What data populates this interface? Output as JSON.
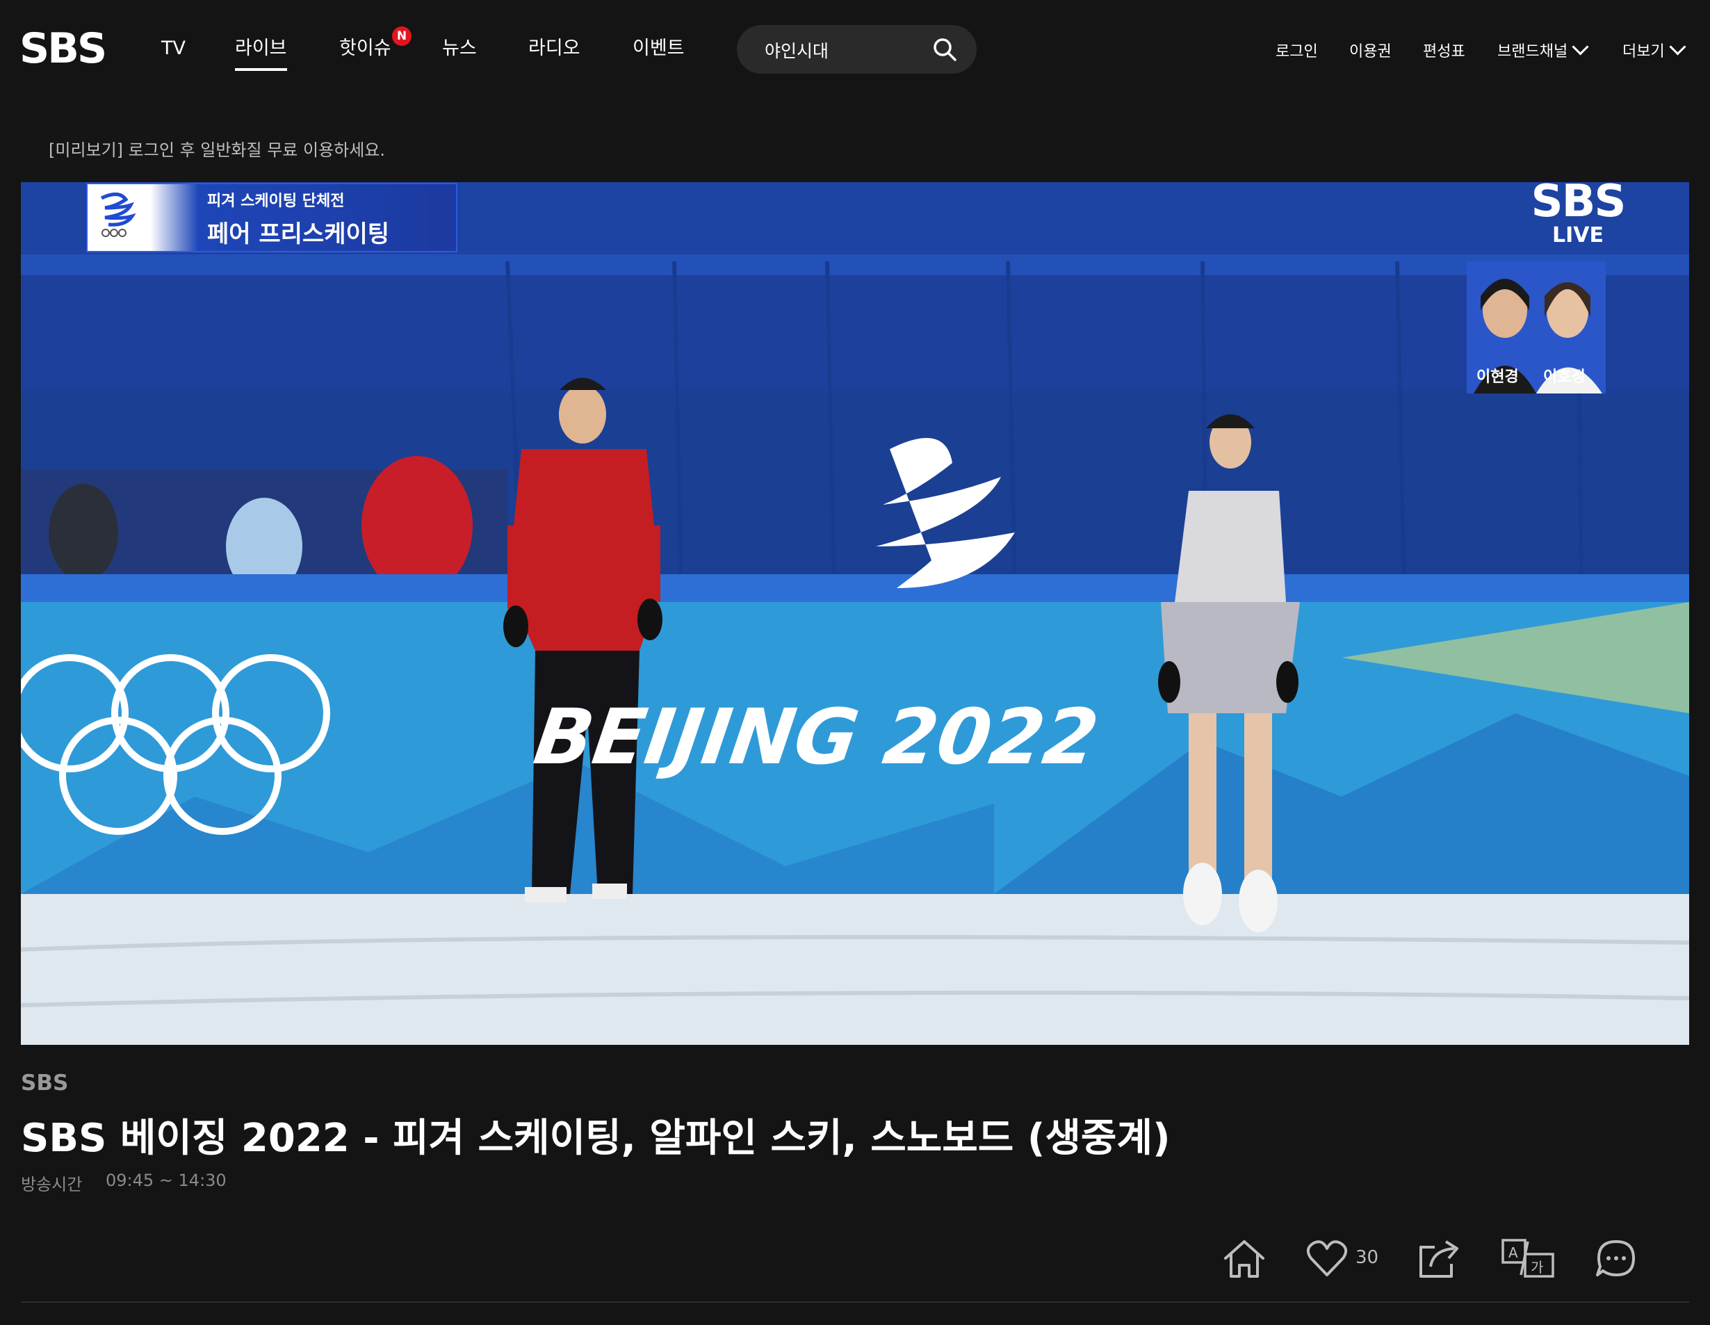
{
  "header": {
    "logo": "SBS",
    "nav": [
      {
        "label": "TV"
      },
      {
        "label": "라이브",
        "active": true
      },
      {
        "label": "핫이슈",
        "badge": "N"
      },
      {
        "label": "뉴스"
      },
      {
        "label": "라디오"
      },
      {
        "label": "이벤트"
      }
    ],
    "search": {
      "value": "야인시대",
      "icon": "search-icon"
    },
    "util": [
      {
        "label": "로그인"
      },
      {
        "label": "이용권"
      },
      {
        "label": "편성표"
      },
      {
        "label": "브랜드채널"
      },
      {
        "label": "더보기"
      }
    ]
  },
  "player": {
    "preview_notice": "[미리보기] 로그인 후 일반화질 무료 이용하세요.",
    "caption_line1": "피겨 스케이팅 단체전",
    "caption_line2": "페어 프리스케이팅",
    "broadcaster_logo": "SBS",
    "live_label": "LIVE",
    "commentators": [
      "이현경",
      "이호정"
    ],
    "venue_text": "BEIJING 2022"
  },
  "info": {
    "channel": "SBS",
    "title": "SBS 베이징 2022 - 피겨 스케이팅, 알파인 스키, 스노보드 (생중계)",
    "air_time_label": "방송시간",
    "air_time": "09:45 ~ 14:30"
  },
  "actions": {
    "like_count": "30",
    "icons": [
      "home-icon",
      "heart-icon",
      "share-icon",
      "translate-icon",
      "comment-icon"
    ]
  },
  "colors": {
    "background": "#141414",
    "accent_badge": "#e4141e",
    "arena_blue": "#1a3f8c"
  }
}
